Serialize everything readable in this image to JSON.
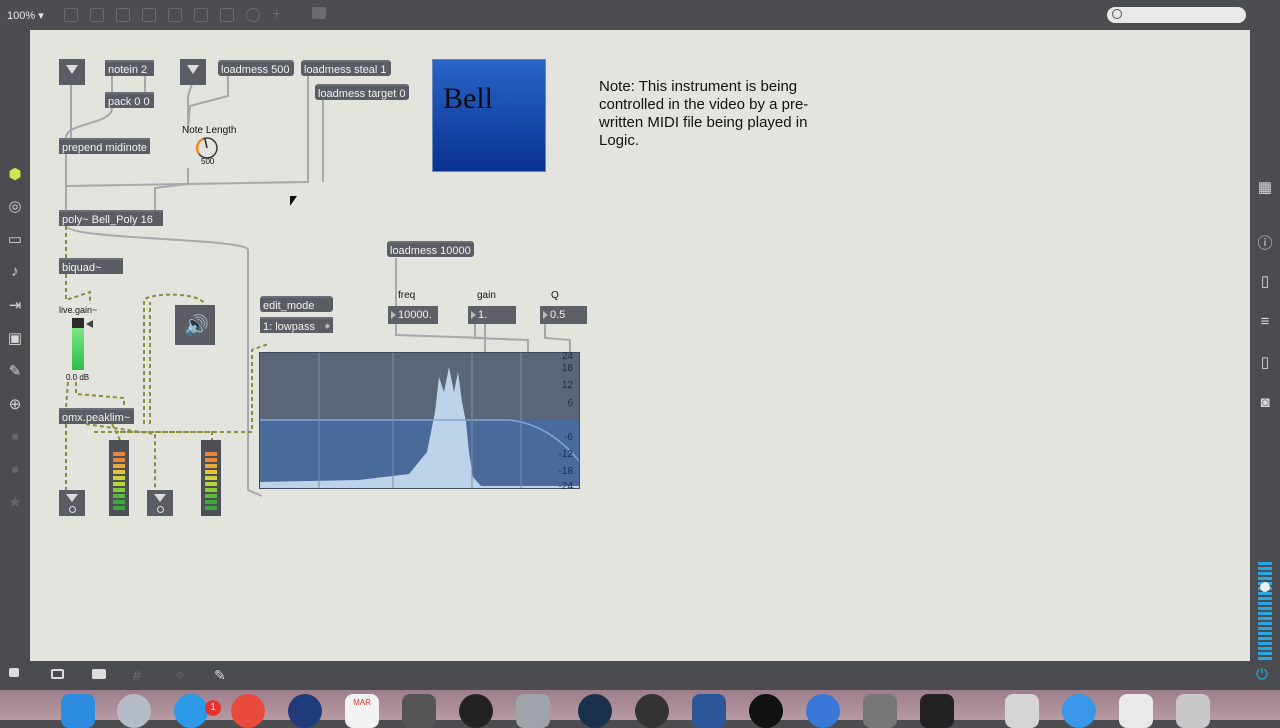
{
  "toolbar": {
    "zoom": "100%",
    "zoom_arrow": "▾"
  },
  "objects": {
    "notein": "notein 2",
    "pack": "pack 0 0",
    "loadmess500": "loadmess 500",
    "loadmess_steal": "loadmess steal 1",
    "loadmess_target": "loadmess target 0",
    "prepend": "prepend midinote",
    "poly": "poly~ Bell_Poly 16",
    "biquad": "biquad~",
    "omx": "omx.peaklim~",
    "loadmess10000": "loadmess 10000",
    "edit_mode": "edit_mode",
    "lowpass": "1: lowpass"
  },
  "labels": {
    "note_length": "Note Length",
    "note_length_value": "500",
    "live_gain": "live.gain~",
    "gain_db": "0.0 dB",
    "freq": "freq",
    "gain": "gain",
    "q": "Q"
  },
  "numboxes": {
    "freq": "10000.",
    "gain": "1.",
    "q": "0.5"
  },
  "bell": {
    "title": "Bell"
  },
  "note": "Note: This instrument is being controlled in the video by a pre-written MIDI file being played in Logic.",
  "filter_axis": [
    "24",
    "18",
    "12",
    "6",
    "-6",
    "-12",
    "-18",
    "-24"
  ],
  "dock": {
    "calendar_month": "MAR",
    "badge": "1"
  },
  "colors": {
    "canvas": "#e4e4df",
    "object": "#5a5d63",
    "accent": "#2864c7"
  }
}
